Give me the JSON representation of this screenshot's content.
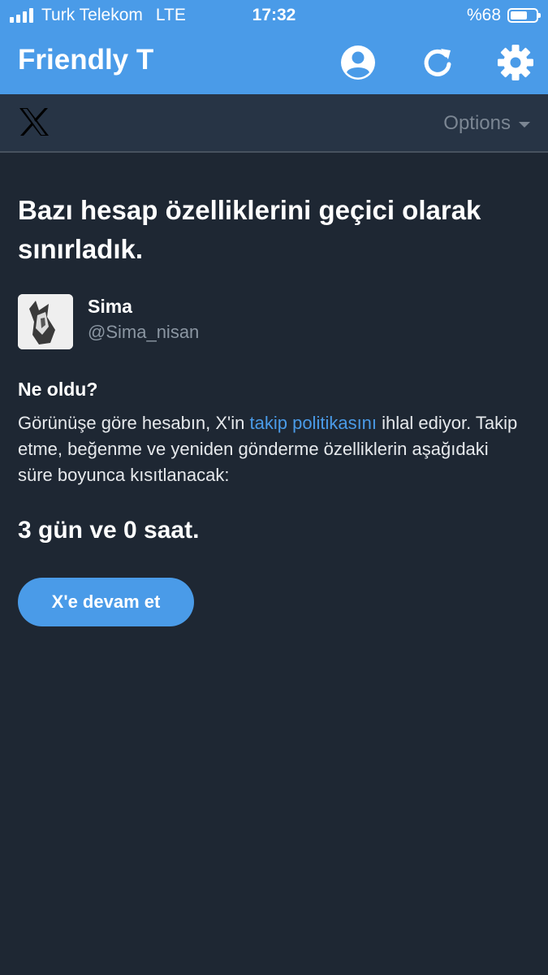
{
  "status_bar": {
    "carrier": "Turk Telekom",
    "network": "LTE",
    "time": "17:32",
    "battery": "%68",
    "battery_level": 0.68
  },
  "app_bar": {
    "title": "Friendly T",
    "icons": [
      "account-icon",
      "refresh-icon",
      "settings-icon"
    ],
    "color": "#4a9be8"
  },
  "x_header": {
    "logo": "x-logo-icon",
    "options_label": "Options"
  },
  "main": {
    "headline": "Bazı hesap özelliklerini geçici olarak sınırladık.",
    "user": {
      "name": "Sima",
      "handle": "@Sima_nisan"
    },
    "question": "Ne oldu?",
    "body_before": "Görünüşe göre hesabın, X'in ",
    "body_link": "takip politikasını",
    "body_after": " ihlal ediyor. Takip etme, beğenme ve yeniden gönderme özelliklerin aşağıdaki süre boyunca kısıtlanacak:",
    "duration": "3 gün ve 0 saat.",
    "continue_label": "X'e devam et"
  },
  "colors": {
    "background": "#1e2733",
    "header": "#273445",
    "accent": "#4a9be8",
    "muted": "#8b96a2"
  }
}
